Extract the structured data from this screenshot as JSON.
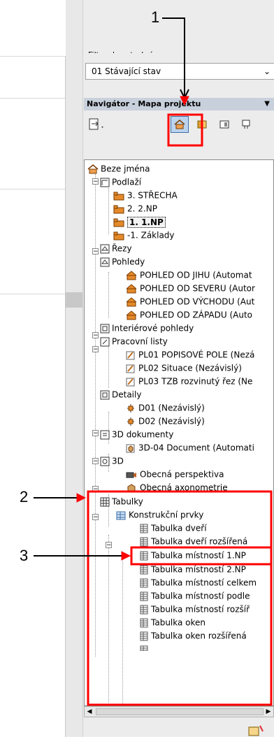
{
  "layer_combination": {
    "label": "Filtr rekonstrukcí",
    "selected_value": "01 Stávající stav"
  },
  "navigator": {
    "title": "Navigátor - Mapa projektu",
    "toolbar": [
      "project-map",
      "view-map",
      "layout-book",
      "publisher"
    ]
  },
  "tree": [
    {
      "label": "Beze jména",
      "icon": "house-icon"
    },
    {
      "label": "Podlaží",
      "icon": "floorplan-icon"
    },
    {
      "label": "3. STŘECHA",
      "icon": "story-icon"
    },
    {
      "label": "2. 2.NP",
      "icon": "story-icon"
    },
    {
      "label": "1. 1.NP",
      "icon": "story-icon"
    },
    {
      "label": "-1. Základy",
      "icon": "story-icon"
    },
    {
      "label": "Řezy",
      "icon": "section-icon"
    },
    {
      "label": "Pohledy",
      "icon": "elevation-icon"
    },
    {
      "label": "POHLED OD JIHU (Automat",
      "icon": "elevation-view-icon"
    },
    {
      "label": "POHLED OD SEVERU (Autor",
      "icon": "elevation-view-icon"
    },
    {
      "label": "POHLED OD VÝCHODU (Aut",
      "icon": "elevation-view-icon"
    },
    {
      "label": "POHLED OD ZÁPADU (Auto",
      "icon": "elevation-view-icon"
    },
    {
      "label": "Interiérové pohledy",
      "icon": "interior-elevation-icon"
    },
    {
      "label": "Pracovní listy",
      "icon": "worksheet-icon"
    },
    {
      "label": "PL01 POPISOVÉ POLE (Nezá",
      "icon": "worksheet-item-icon"
    },
    {
      "label": "PL02 Situace (Nezávislý)",
      "icon": "worksheet-item-icon"
    },
    {
      "label": "PL03 TZB rozvinutý řez (Ne",
      "icon": "worksheet-item-icon"
    },
    {
      "label": "Detaily",
      "icon": "detail-icon"
    },
    {
      "label": "D01 (Nezávislý)",
      "icon": "detail-item-icon"
    },
    {
      "label": "D02 (Nezávislý)",
      "icon": "detail-item-icon"
    },
    {
      "label": "3D dokumenty",
      "icon": "3d-document-icon"
    },
    {
      "label": "3D-04 Document (Automati",
      "icon": "3d-document-item-icon"
    },
    {
      "label": "3D",
      "icon": "3d-icon"
    },
    {
      "label": "Obecná perspektiva",
      "icon": "camera-icon"
    },
    {
      "label": "Obecná axonometrie",
      "icon": "axonometry-icon"
    },
    {
      "label": "Tabulky",
      "icon": "schedule-icon"
    },
    {
      "label": "Konstrukční prvky",
      "icon": "element-schedule-icon"
    },
    {
      "label": "Tabulka dveří",
      "icon": "table-icon"
    },
    {
      "label": "Tabulka dveří rozšířená",
      "icon": "table-icon"
    },
    {
      "label": "Tabulka místností 1.NP",
      "icon": "table-icon"
    },
    {
      "label": "Tabulka místností 2.NP",
      "icon": "table-icon"
    },
    {
      "label": "Tabulka místností celkem",
      "icon": "table-icon"
    },
    {
      "label": "Tabulka místností podle",
      "icon": "table-icon"
    },
    {
      "label": "Tabulka místností rozšíř",
      "icon": "table-icon"
    },
    {
      "label": "Tabulka oken",
      "icon": "table-icon"
    },
    {
      "label": "Tabulka oken rozšířená",
      "icon": "table-icon"
    }
  ],
  "callouts": [
    "1",
    "2",
    "3"
  ]
}
